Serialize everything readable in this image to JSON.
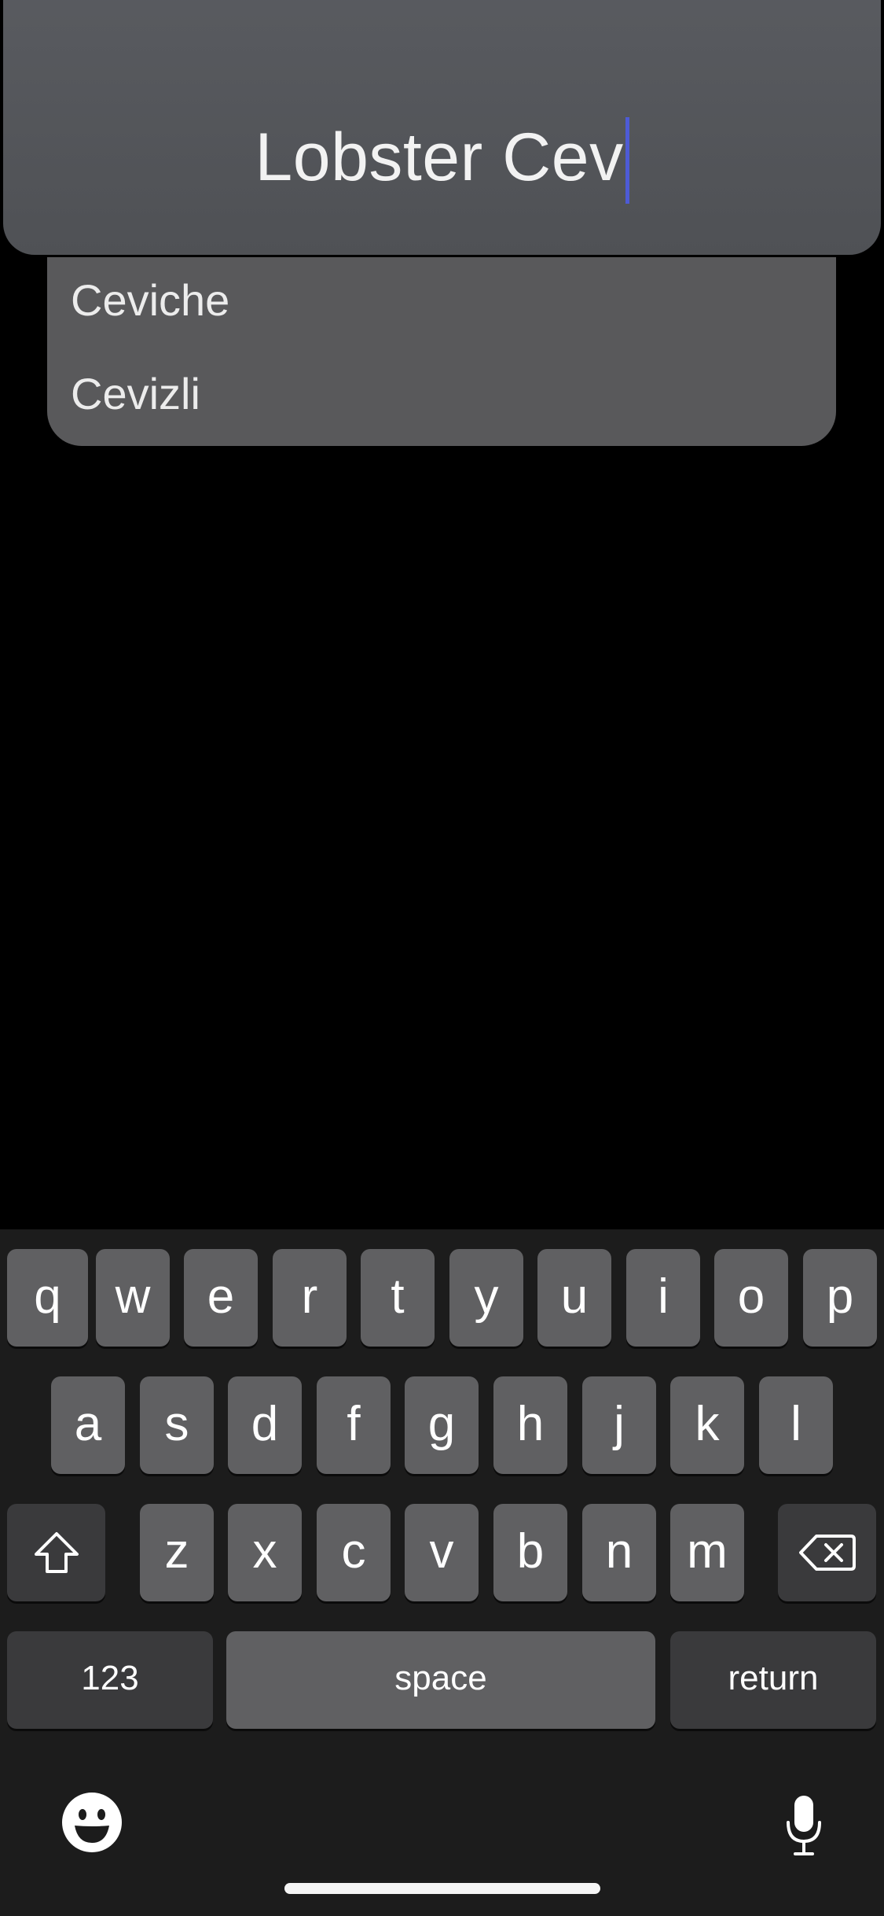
{
  "search": {
    "value": "Lobster Cev"
  },
  "suggestions": [
    {
      "label": "Ceviche"
    },
    {
      "label": "Cevizli"
    }
  ],
  "keyboard": {
    "row1": [
      "q",
      "w",
      "e",
      "r",
      "t",
      "y",
      "u",
      "i",
      "o",
      "p"
    ],
    "row2": [
      "a",
      "s",
      "d",
      "f",
      "g",
      "h",
      "j",
      "k",
      "l"
    ],
    "row3": [
      "z",
      "x",
      "c",
      "v",
      "b",
      "n",
      "m"
    ],
    "numbers_label": "123",
    "space_label": "space",
    "return_label": "return",
    "icons": {
      "shift": "shift-icon",
      "delete": "delete-icon",
      "emoji": "emoji-icon",
      "mic": "microphone-icon"
    }
  },
  "colors": {
    "caret": "#4d5bd6",
    "key": "#606062",
    "key_dark": "#3a3a3c",
    "keyboard_bg": "#1c1c1c"
  }
}
